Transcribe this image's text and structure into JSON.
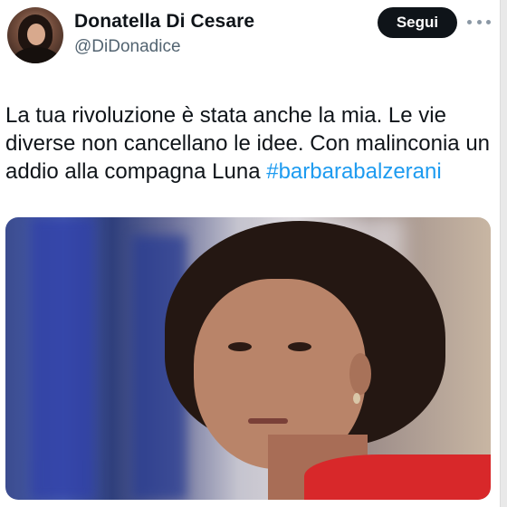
{
  "author": {
    "name": "Donatella Di Cesare",
    "handle": "@DiDonadice"
  },
  "actions": {
    "follow_label": "Segui",
    "more_icon": "more-dots-icon"
  },
  "tweet": {
    "text_before": "La tua rivoluzione è stata anche la mia. Le vie diverse non cancellano le idee. Con malinconia un addio alla compagna Luna ",
    "hashtag": "#barbarabalzerani"
  },
  "colors": {
    "link": "#1d9bf0",
    "button_bg": "#0f1419",
    "secondary_text": "#536471"
  }
}
